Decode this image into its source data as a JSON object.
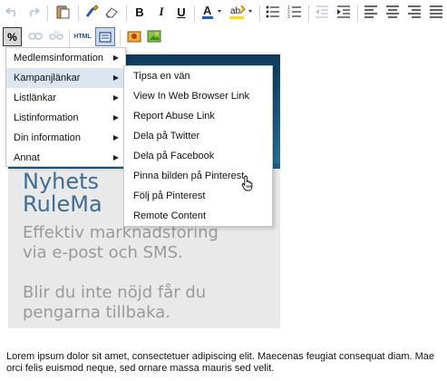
{
  "toolbar": {
    "row1": [
      {
        "name": "undo-icon",
        "glyph": "↶",
        "disabled": true
      },
      {
        "name": "redo-icon",
        "glyph": "↷",
        "disabled": true
      },
      {
        "name": "paste-icon",
        "glyph": "📋",
        "disabled": false
      },
      {
        "name": "format-brush-icon",
        "glyph": "🖌",
        "disabled": false
      },
      {
        "name": "eraser-icon",
        "glyph": "⌫",
        "disabled": false
      },
      {
        "name": "bold-button",
        "glyph": "B",
        "disabled": false
      },
      {
        "name": "italic-button",
        "glyph": "I",
        "disabled": false
      },
      {
        "name": "underline-button",
        "glyph": "U",
        "disabled": false
      },
      {
        "name": "font-color-button",
        "glyph": "A",
        "disabled": false
      },
      {
        "name": "highlight-color-button",
        "glyph": "ab",
        "disabled": false
      },
      {
        "name": "bullet-list-icon",
        "glyph": "☰",
        "disabled": false
      },
      {
        "name": "numbered-list-icon",
        "glyph": "≣",
        "disabled": false
      },
      {
        "name": "outdent-icon",
        "glyph": "⇤",
        "disabled": true
      },
      {
        "name": "indent-icon",
        "glyph": "⇥",
        "disabled": false
      },
      {
        "name": "align-left-icon",
        "glyph": "≡",
        "disabled": false
      },
      {
        "name": "align-center-icon",
        "glyph": "≡",
        "disabled": false
      },
      {
        "name": "align-right-icon",
        "glyph": "≡",
        "disabled": false
      },
      {
        "name": "align-justify-icon",
        "glyph": "≡",
        "disabled": false
      }
    ],
    "row2": {
      "merge_tags_label": "%",
      "html_label": "HTML"
    }
  },
  "menu": {
    "items": [
      {
        "label": "Medlemsinformation",
        "highlighted": false
      },
      {
        "label": "Kampanjlänkar",
        "highlighted": true
      },
      {
        "label": "Listlänkar",
        "highlighted": false
      },
      {
        "label": "Listinformation",
        "highlighted": false
      },
      {
        "label": "Din information",
        "highlighted": false
      },
      {
        "label": "Annat",
        "highlighted": false
      }
    ],
    "arrow": "▶"
  },
  "submenu": {
    "items": [
      "Tipsa en vän",
      "View In Web Browser Link",
      "Report Abuse Link",
      "Dela på Twitter",
      "Dela på Facebook",
      "Pinna bilden på Pinterest",
      "Följ på Pinterest",
      "Remote Content"
    ]
  },
  "banner": {
    "title": "Nyhets\nRuleMa",
    "tagline1": "Effektiv marknadsföring\nvia e-post och SMS.",
    "tagline2": "Blir du inte nöjd får du\npengarna tillbaka.",
    "colors": {
      "dark": "#0f3a5a",
      "title": "#3e6e95",
      "tag": "#9a9a9a"
    }
  },
  "body_text": {
    "line1": "Lorem ipsum dolor sit amet, consectetuer adipiscing elit. Maecenas feugiat consequat diam. Mae",
    "line2": "orci felis euismod neque, sed ornare massa mauris sed velit."
  }
}
